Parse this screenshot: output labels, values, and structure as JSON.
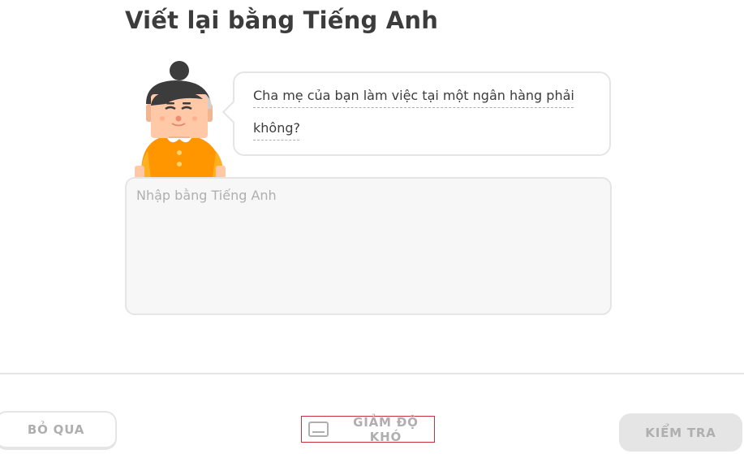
{
  "header": {
    "title": "Viết lại bằng Tiếng Anh"
  },
  "prompt": {
    "text": "Cha mẹ của bạn làm việc tại một ngân hàng phải không?"
  },
  "answer": {
    "value": "",
    "placeholder": "Nhập bằng Tiếng Anh"
  },
  "footer": {
    "skip_label": "BỎ QUA",
    "easier_label": "GIẢM ĐỘ KHÓ",
    "check_label": "KIỂM TRA"
  },
  "icons": {
    "character": "character-avatar-icon",
    "keyboard": "keyboard-icon"
  },
  "colors": {
    "text": "#3c3c3c",
    "muted": "#afafaf",
    "border": "#e5e5e5",
    "input_bg": "#f7f7f7",
    "highlight": "#c8323c",
    "character_shirt": "#ff9600",
    "character_skin": "#ffc9a8",
    "character_hair": "#3c3c3c"
  }
}
